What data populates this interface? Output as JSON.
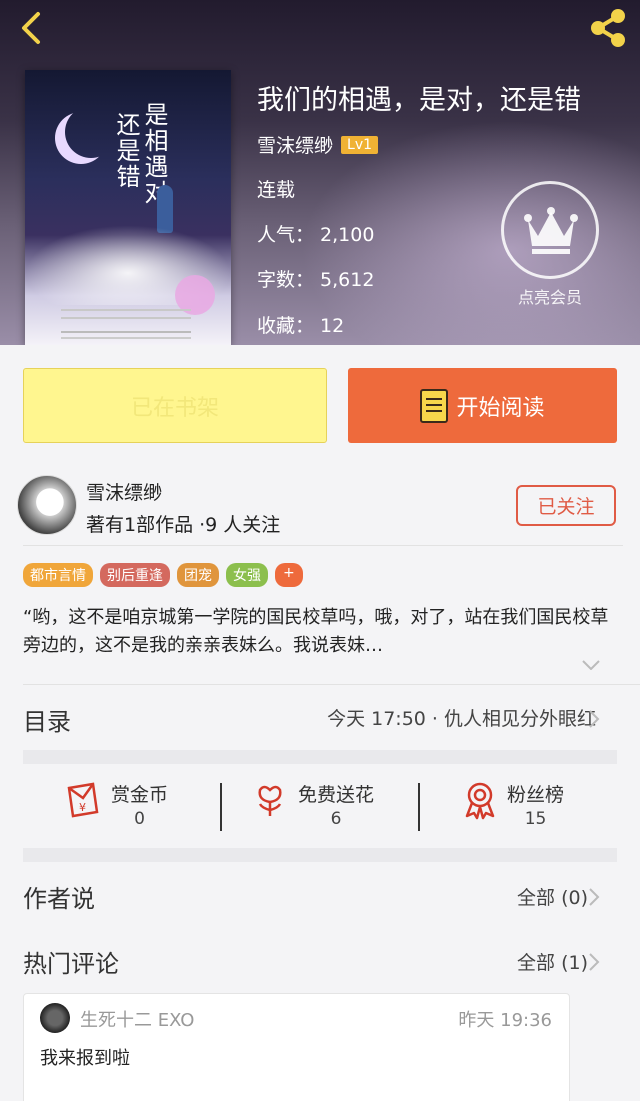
{
  "hero": {
    "title": "我们的相遇，是对，还是错",
    "author": "雪沫缥缈",
    "level": "Lv1",
    "status": "连载",
    "popularity_label": "人气：",
    "popularity": "2,100",
    "words_label": "字数：",
    "words": "5,612",
    "favorites_label": "收藏：",
    "favorites": "12",
    "vip_label": "点亮会员",
    "cover_title_right": "是相遇对",
    "cover_title_left": "还是错"
  },
  "buttons": {
    "shelf": "已在书架",
    "read": "开始阅读"
  },
  "author_card": {
    "name": "雪沫缥缈",
    "works": "著有1部作品 ·9 人关注",
    "follow": "已关注"
  },
  "tags": [
    "都市言情",
    "别后重逢",
    "团宠",
    "女强",
    "+"
  ],
  "intro": "“哟，这不是咱京城第一学院的国民校草吗，哦，对了，站在我们国民校草旁边的，这不是我的亲亲表妹么。我说表妹…",
  "toc": {
    "label": "目录",
    "latest": "今天 17:50 · 仇人相见分外眼红"
  },
  "stats": [
    {
      "label": "赏金币",
      "value": "0",
      "icon": "red-envelope-icon"
    },
    {
      "label": "免费送花",
      "value": "6",
      "icon": "flower-icon"
    },
    {
      "label": "粉丝榜",
      "value": "15",
      "icon": "medal-icon"
    }
  ],
  "author_says": {
    "label": "作者说",
    "all": "全部 (0)"
  },
  "hot_comments": {
    "label": "热门评论",
    "all": "全部 (1)"
  },
  "comment": {
    "user": "生死十二 EXO",
    "time": "昨天 19:36",
    "text": "我来报到啦"
  },
  "colors": {
    "accent": "#ee6a3c",
    "shelf_bg": "#fff68f",
    "follow": "#e05b45",
    "level": "#f0b234"
  }
}
